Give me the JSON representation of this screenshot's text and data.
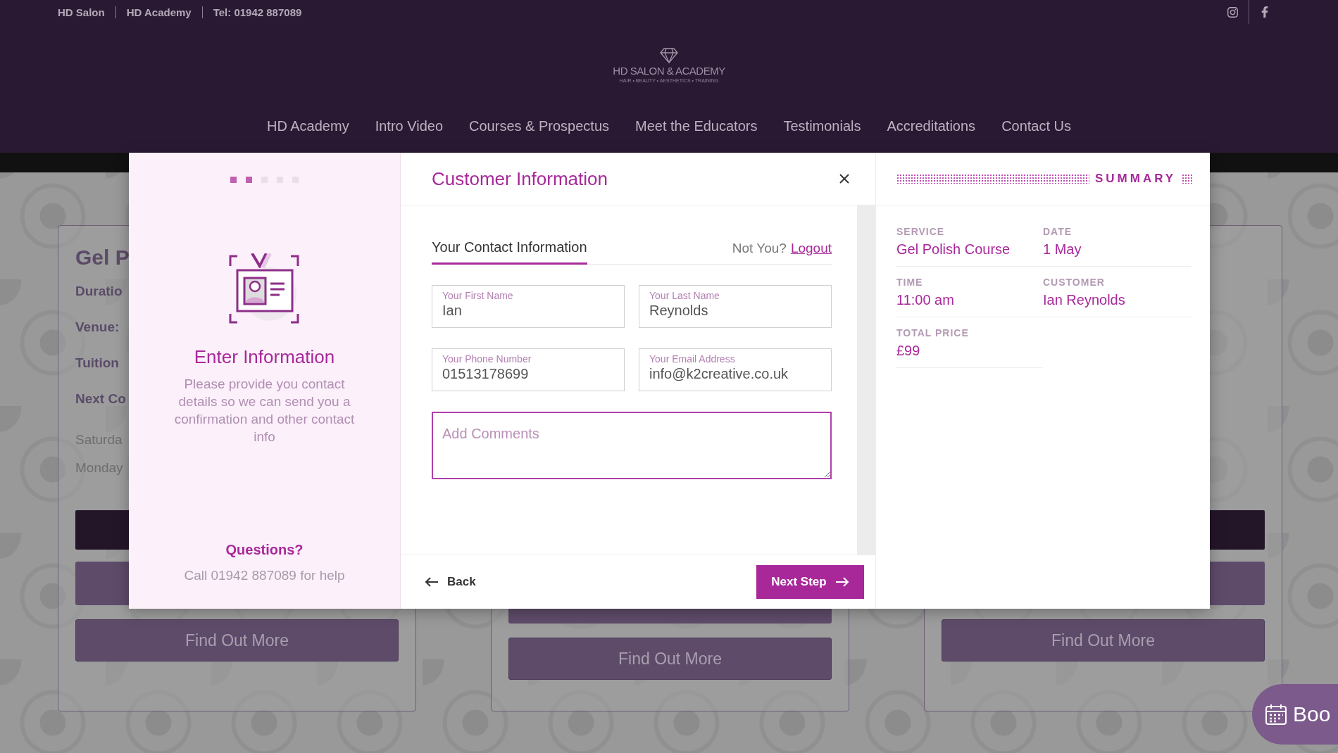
{
  "top_bar": {
    "links": [
      "HD Salon",
      "HD Academy",
      "Tel: 01942 887089"
    ]
  },
  "logo": {
    "name": "HD SALON & ACADEMY",
    "tagline": "HAIR • BEAUTY • AESTHETICS • TRAINING"
  },
  "nav": [
    "HD Academy",
    "Intro Video",
    "Courses & Prospectus",
    "Meet the Educators",
    "Testimonials",
    "Accreditations",
    "Contact Us"
  ],
  "background_cards": [
    {
      "title": "Gel P",
      "details": [
        "Duratio",
        "Venue:",
        "Tuition",
        "Next Co"
      ],
      "dates": [
        "Saturda",
        "Monday"
      ],
      "button": "Find Out More"
    },
    {
      "button": "Find Out More"
    },
    {
      "button": "Find Out More"
    }
  ],
  "book_button": {
    "label": "Boo"
  },
  "modal": {
    "steps": [
      {
        "done": true
      },
      {
        "done": true
      },
      {
        "done": false
      },
      {
        "done": false
      },
      {
        "done": false
      }
    ],
    "side": {
      "title": "Enter Information",
      "text": "Please provide you contact details so we can send you a confirmation and other contact info",
      "help_title": "Questions?",
      "help_text": "Call 01942 887089 for help"
    },
    "form": {
      "title": "Customer Information",
      "section": "Your Contact Information",
      "not_you": "Not You?",
      "logout": "Logout",
      "fields": [
        {
          "label": "Your First Name",
          "value": "Ian"
        },
        {
          "label": "Your Last Name",
          "value": "Reynolds"
        },
        {
          "label": "Your Phone Number",
          "value": "01513178699"
        },
        {
          "label": "Your Email Address",
          "value": "info@k2creative.co.uk"
        }
      ],
      "comments": {
        "placeholder": "Add Comments"
      },
      "back": "Back",
      "next": "Next Step"
    },
    "summary": {
      "title": "SUMMARY",
      "items": [
        {
          "label": "SERVICE",
          "value": "Gel Polish Course"
        },
        {
          "label": "DATE",
          "value": "1 May"
        },
        {
          "label": "TIME",
          "value": "11:00 am"
        },
        {
          "label": "CUSTOMER",
          "value": "Ian Reynolds"
        },
        {
          "label": "TOTAL PRICE",
          "value": "£99"
        }
      ]
    }
  }
}
